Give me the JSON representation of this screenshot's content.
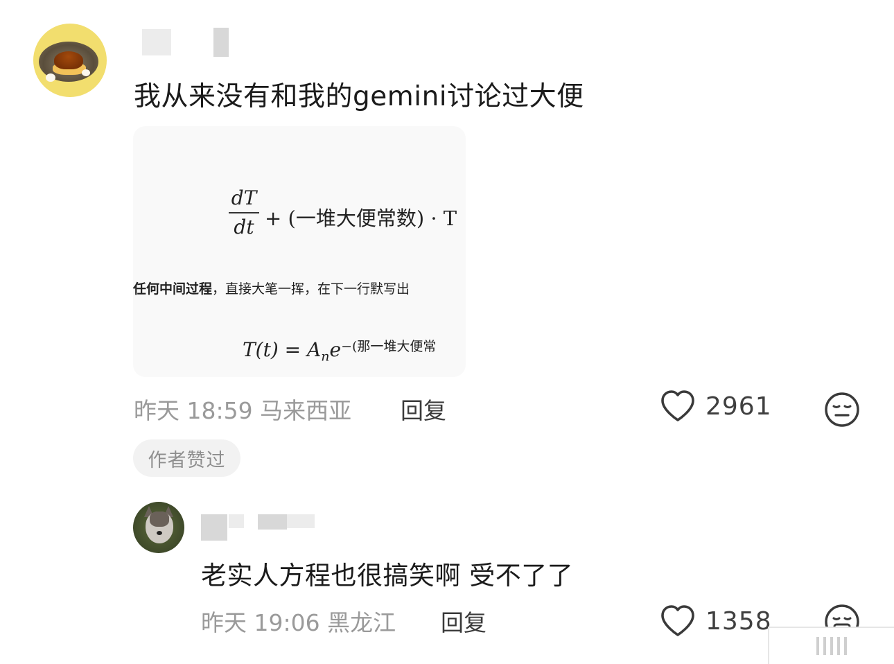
{
  "main_comment": {
    "text": "我从来没有和我的gemini讨论过大便",
    "image": {
      "eq1_numerator": "dT",
      "eq1_denominator": "dt",
      "eq1_rest": "+ (一堆大便常数) · T",
      "mid_bold": "任何中间过程",
      "mid_rest": "，直接大笔一挥，在下一行默写出",
      "eq2_base": "T(t) = A",
      "eq2_sub": "n",
      "eq2_e": "e",
      "eq2_sup": "−(那一堆大便常"
    },
    "time": "昨天 18:59",
    "location": "马来西亚",
    "reply_label": "回复",
    "like_count": "2961",
    "author_liked_badge": "作者赞过"
  },
  "reply_comment": {
    "text": "老实人方程也很搞笑啊 受不了了",
    "time": "昨天 19:06",
    "location": "黑龙江",
    "reply_label": "回复",
    "like_count": "1358"
  },
  "icons": {
    "like": "heart-outline-icon",
    "dislike_main": "neutral-face-icon",
    "dislike_reply": "grimace-face-icon"
  }
}
